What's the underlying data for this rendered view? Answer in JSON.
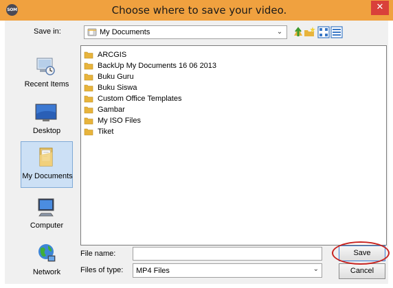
{
  "window": {
    "title": "Choose where to save your video.",
    "app_icon_text": "SOM",
    "close_glyph": "✕"
  },
  "toolbar": {
    "save_in_label": "Save in:",
    "save_in_value": "My Documents",
    "dropdown_glyph": "⌄",
    "icons": [
      "folder-icon",
      "up-one-level-icon",
      "new-folder-icon",
      "view-menu-icon",
      "list-view-icon"
    ]
  },
  "places": [
    {
      "label": "Recent Items",
      "icon": "recent-items-icon",
      "selected": false
    },
    {
      "label": "Desktop",
      "icon": "desktop-icon",
      "selected": false
    },
    {
      "label": "My Documents",
      "icon": "my-documents-icon",
      "selected": true
    },
    {
      "label": "Computer",
      "icon": "computer-icon",
      "selected": false
    },
    {
      "label": "Network",
      "icon": "network-icon",
      "selected": false
    }
  ],
  "files": [
    {
      "name": "ARCGIS",
      "type": "folder"
    },
    {
      "name": "BackUp My Documents 16 06 2013",
      "type": "folder"
    },
    {
      "name": "Buku Guru",
      "type": "folder"
    },
    {
      "name": "Buku Siswa",
      "type": "folder"
    },
    {
      "name": "Custom Office Templates",
      "type": "folder"
    },
    {
      "name": "Gambar",
      "type": "folder"
    },
    {
      "name": "My ISO Files",
      "type": "folder"
    },
    {
      "name": "Tiket",
      "type": "folder"
    }
  ],
  "form": {
    "file_name_label": "File name:",
    "file_name_value": "",
    "file_type_label": "Files of type:",
    "file_type_value": "MP4 Files",
    "save_label": "Save",
    "cancel_label": "Cancel"
  },
  "colors": {
    "title_bar": "#f0a13f",
    "close_button": "#d9403a",
    "selection": "#cce0f5",
    "highlight_circle": "#c8231f",
    "folder": "#e8b43c"
  }
}
